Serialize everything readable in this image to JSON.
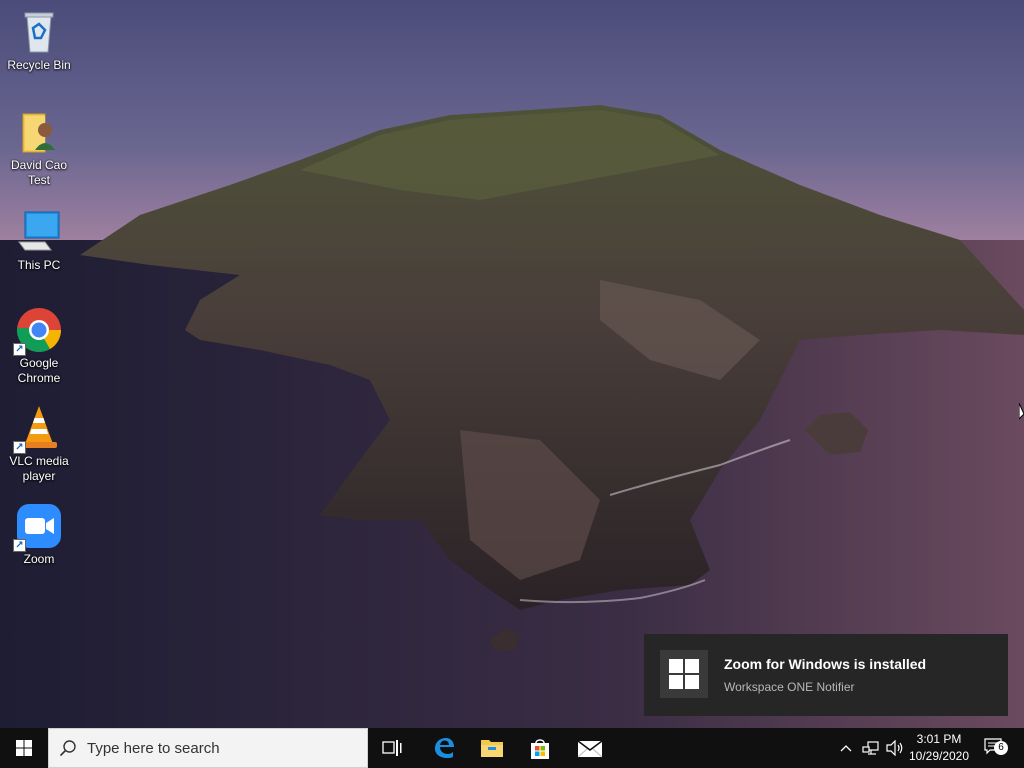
{
  "desktop": {
    "icons": [
      {
        "label": "Recycle Bin",
        "icon": "recycle-bin-icon"
      },
      {
        "label": "David Cao Test",
        "icon": "user-folder-icon"
      },
      {
        "label": "This PC",
        "icon": "this-pc-icon"
      },
      {
        "label": "Google Chrome",
        "icon": "chrome-icon"
      },
      {
        "label": "VLC media player",
        "icon": "vlc-icon"
      },
      {
        "label": "Zoom",
        "icon": "zoom-icon"
      }
    ]
  },
  "toast": {
    "title": "Zoom for Windows is installed",
    "subtitle": "Workspace ONE Notifier"
  },
  "taskbar": {
    "search_placeholder": "Type here to search",
    "apps": [
      "task-view-icon",
      "edge-icon",
      "file-explorer-icon",
      "store-icon",
      "mail-icon"
    ],
    "clock_time": "3:01 PM",
    "clock_date": "10/29/2020",
    "notification_count": "6"
  },
  "colors": {
    "taskbar": "#101010",
    "toast_bg": "#262626",
    "accent": "#0078d7",
    "zoom_blue": "#2d8cff"
  }
}
